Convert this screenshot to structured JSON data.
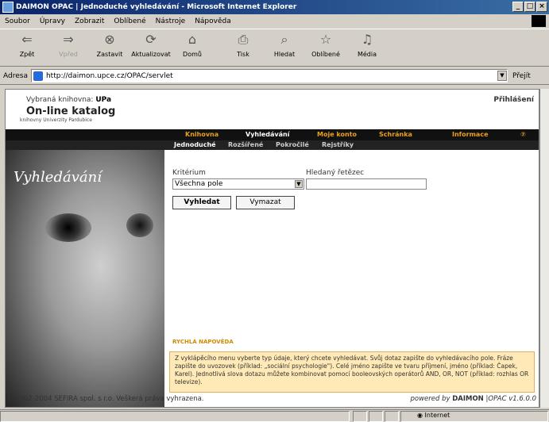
{
  "window": {
    "title": "DAIMON OPAC | Jednoduché vyhledávání - Microsoft Internet Explorer",
    "controls": [
      "_",
      "□",
      "×"
    ]
  },
  "menu": [
    "Soubor",
    "Úpravy",
    "Zobrazit",
    "Oblíbené",
    "Nástroje",
    "Nápověda"
  ],
  "toolbar": [
    {
      "label": "Zpět",
      "icon": "back-icon",
      "glyph": "⇐",
      "disabled": false
    },
    {
      "label": "Vpřed",
      "icon": "forward-icon",
      "glyph": "⇒",
      "disabled": true
    },
    {
      "label": "Zastavit",
      "icon": "stop-icon",
      "glyph": "⊗",
      "disabled": false
    },
    {
      "label": "Aktualizovat",
      "icon": "refresh-icon",
      "glyph": "⟳",
      "disabled": false
    },
    {
      "label": "Domů",
      "icon": "home-icon",
      "glyph": "⌂",
      "disabled": false
    },
    {
      "label": "Tisk",
      "icon": "print-icon",
      "glyph": "⎙",
      "disabled": false
    },
    {
      "label": "Hledat",
      "icon": "search-icon",
      "glyph": "⌕",
      "disabled": false
    },
    {
      "label": "Oblíbené",
      "icon": "favorites-icon",
      "glyph": "☆",
      "disabled": false
    },
    {
      "label": "Média",
      "icon": "media-icon",
      "glyph": "♫",
      "disabled": false
    }
  ],
  "address": {
    "label": "Adresa",
    "url": "http://daimon.upce.cz/OPAC/servlet",
    "go": "Přejít"
  },
  "header": {
    "library_prefix": "Vybraná knihovna:",
    "library_name": "UPa",
    "login": "Přihlášení",
    "catalog_title": "On-line katalog",
    "catalog_subtitle": "knihovny Univerzity Pardubice"
  },
  "nav": [
    {
      "label": "Knihovna",
      "color": "#e8a020"
    },
    {
      "label": "Vyhledávání",
      "color": "#ffffff"
    },
    {
      "label": "Moje konto",
      "color": "#e8a020"
    },
    {
      "label": "Schránka",
      "color": "#e8a020"
    },
    {
      "label": "Informace",
      "color": "#e8a020"
    },
    {
      "label": "⑦",
      "color": "#e8a020"
    }
  ],
  "subnav": [
    "Jednoduché",
    "Rozšířené",
    "Pokročilé",
    "Rejstříky"
  ],
  "main": {
    "section_title": "Vyhledávání",
    "criterion_label": "Kritérium",
    "criterion_value": "Všechna pole",
    "search_label": "Hledaný řetězec",
    "search_value": "",
    "search_button": "Vyhledat",
    "clear_button": "Vymazat"
  },
  "help": {
    "title": "RYCHLÁ NÁPOVĚDA",
    "text": "Z vyklápěcího menu vyberte typ údaje, který chcete vyhledávat. Svůj dotaz zapište do vyhledávacího pole. Fráze zapište do uvozovek (příklad: „sociální psychologie\"). Celé jméno zapište ve tvaru příjmení, jméno (příklad: Čapek, Karel). Jednotlivá slova dotazu můžete kombinovat pomocí booleovských operátorů AND, OR, NOT (příklad: rozhlas OR televize)."
  },
  "footer": {
    "copyright": "© 2002-2004 SEFIRA spol. s r.o. Veškerá práva vyhrazena.",
    "powered_prefix": "powered by",
    "powered_brand": "DAIMON",
    "version": "|OPAC v1.6.0.0"
  },
  "status": {
    "zone": "Internet"
  },
  "colors": {
    "accent": "#e8a020",
    "titlebar": "#0a246a"
  }
}
